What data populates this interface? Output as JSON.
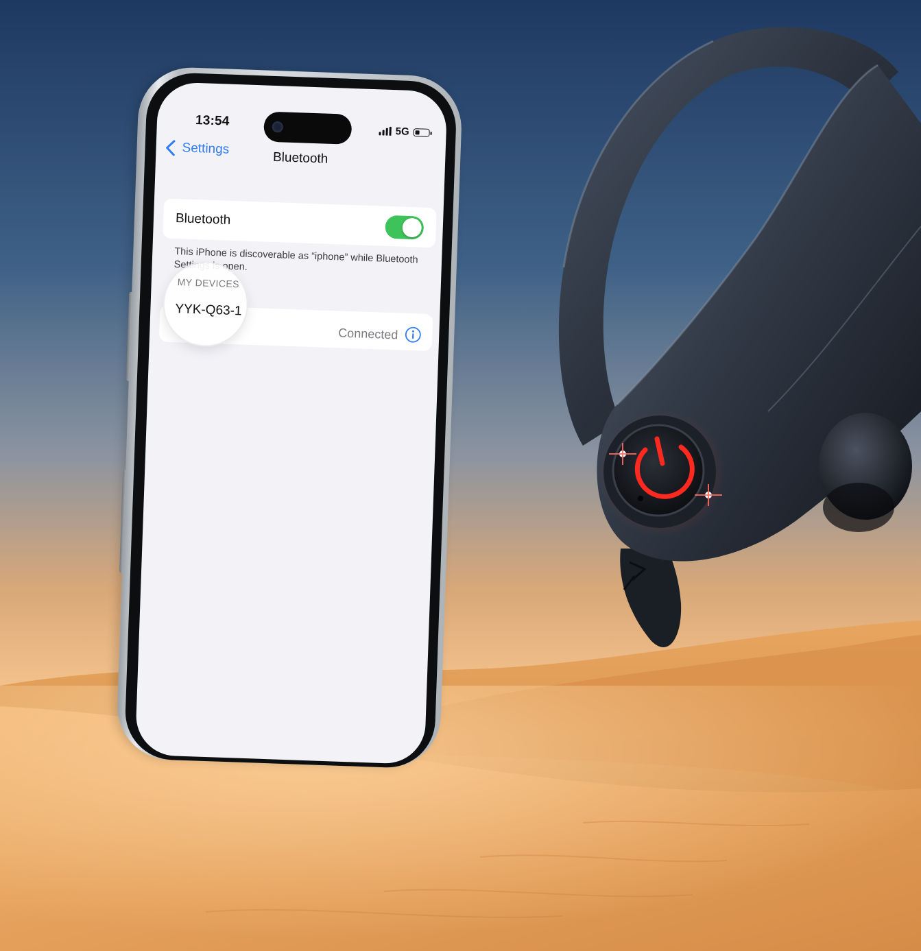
{
  "status_bar": {
    "time": "13:54",
    "network": "5G",
    "battery_level": 0.35
  },
  "nav": {
    "back_label": "Settings",
    "title": "Bluetooth"
  },
  "bluetooth": {
    "label": "Bluetooth",
    "enabled": true,
    "footnote": "This iPhone is discoverable as “iphone” while Bluetooth Settings is open."
  },
  "devices": {
    "section_header": "MY DEVICES",
    "items": [
      {
        "name": "YYK-Q63-1",
        "status": "Connected"
      }
    ]
  },
  "earbud": {
    "side_marker": "R"
  },
  "colors": {
    "ios_blue": "#2f7cf6",
    "toggle_on": "#3ec35a",
    "power_led_red": "#ff2a1f",
    "sky_top": "#1f3a63",
    "sky_horizon": "#e7a86a",
    "sand": "#e9a45d"
  },
  "icons": [
    "chevron-left-icon",
    "signal-icon",
    "battery-icon",
    "info-icon",
    "power-icon"
  ]
}
